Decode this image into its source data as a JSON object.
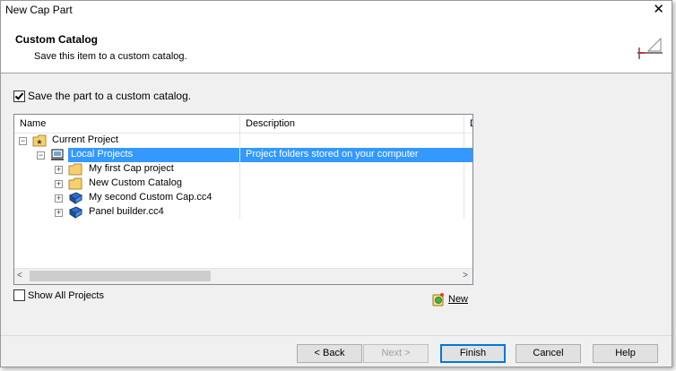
{
  "window": {
    "title": "New Cap Part",
    "close_glyph": "✕"
  },
  "banner": {
    "title": "Custom Catalog",
    "subtitle": "Save this item to a custom catalog.",
    "icon": "drafting-tool-icon"
  },
  "save_checkbox": {
    "label": "Save the part to a custom catalog.",
    "checked": true
  },
  "tree": {
    "columns": {
      "name": "Name",
      "description": "Description",
      "extra": "D"
    },
    "rows": [
      {
        "label": "Current Project",
        "description": "",
        "icon": "project-folder-icon",
        "expander": "−"
      },
      {
        "label": "Local Projects",
        "description": "Project folders stored on your computer",
        "icon": "computer-icon",
        "expander": "−",
        "selected": true
      },
      {
        "label": "My first Cap project",
        "description": "",
        "icon": "folder-icon",
        "expander": "+"
      },
      {
        "label": "New Custom Catalog",
        "description": "",
        "icon": "folder-icon",
        "expander": "+"
      },
      {
        "label": "My second Custom Cap.cc4",
        "description": "",
        "icon": "book-icon",
        "expander": "+"
      },
      {
        "label": "Panel builder.cc4",
        "description": "",
        "icon": "book-icon",
        "expander": "+"
      }
    ],
    "scroll": {
      "left": "<",
      "right": ">"
    }
  },
  "show_all": {
    "label": "Show All Projects",
    "checked": false
  },
  "new_link": {
    "label": "New",
    "icon": "new-catalog-icon"
  },
  "buttons": {
    "back": "< Back",
    "next": "Next >",
    "finish": "Finish",
    "cancel": "Cancel",
    "help": "Help"
  },
  "colors": {
    "selection": "#3399ff",
    "accent": "#0078d7"
  }
}
